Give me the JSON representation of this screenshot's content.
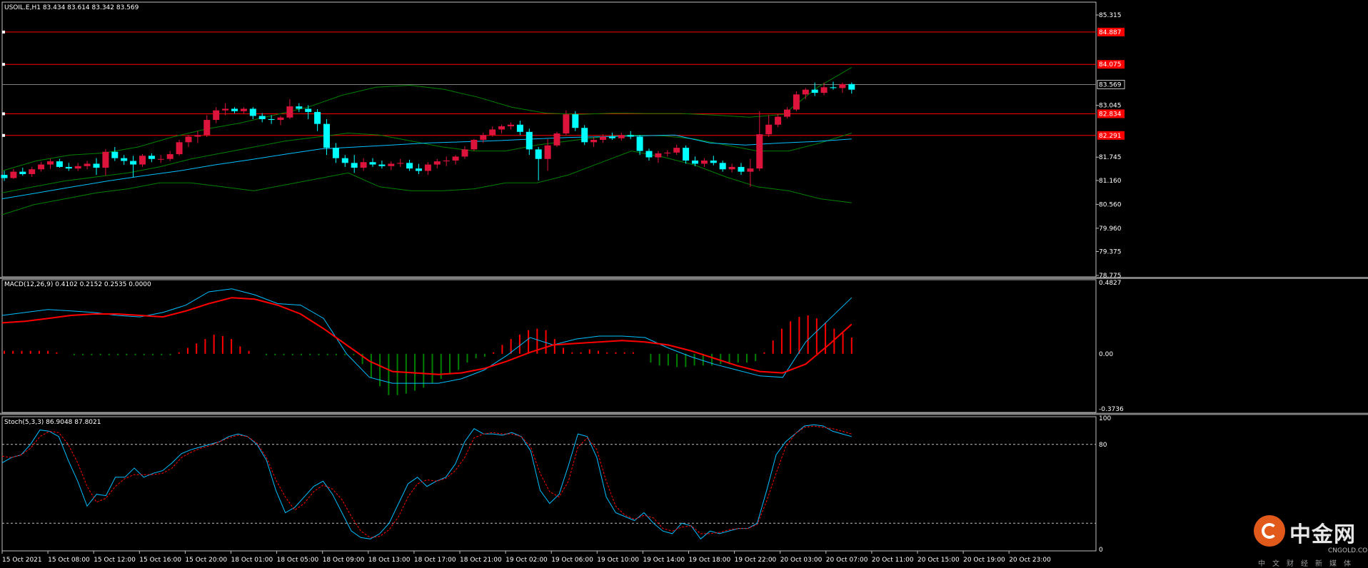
{
  "symbol_line": "USOIL.E,H1  83.434 83.614 83.342 83.569",
  "macd_label": "MACD(12,26,9) 0.4102 0.2152 0.2535 0.0000",
  "stoch_label": "Stoch(5,3,3) 86.9048 87.8021",
  "price_axis": [
    "85.315",
    "84.887",
    "84.075",
    "83.569",
    "83.045",
    "82.834",
    "82.291",
    "81.745",
    "81.160",
    "80.560",
    "79.960",
    "79.375",
    "78.775"
  ],
  "macd_axis": [
    "0.4827",
    "0.00",
    "-0.3736"
  ],
  "stoch_axis": [
    "100",
    "80",
    "0"
  ],
  "time_axis": [
    "15 Oct 2021",
    "15 Oct 08:00",
    "15 Oct 12:00",
    "15 Oct 16:00",
    "15 Oct 20:00",
    "18 Oct 01:00",
    "18 Oct 05:00",
    "18 Oct 09:00",
    "18 Oct 13:00",
    "18 Oct 17:00",
    "18 Oct 21:00",
    "19 Oct 02:00",
    "19 Oct 06:00",
    "19 Oct 10:00",
    "19 Oct 14:00",
    "19 Oct 18:00",
    "19 Oct 22:00",
    "20 Oct 03:00",
    "20 Oct 07:00",
    "20 Oct 11:00",
    "20 Oct 15:00",
    "20 Oct 19:00",
    "20 Oct 23:00"
  ],
  "logo": {
    "name": "中金网",
    "url": "CNGOLD.COM.CN",
    "sub": "中文财经新媒体"
  },
  "colors": {
    "bull": "#00ffff",
    "bear": "#dc143c",
    "macd_signal": "#ff0000",
    "macd_pos": "#ff0000",
    "macd_neg": "#008000",
    "bands": "#008000",
    "ma": "#00bfff",
    "level": "#ff0000",
    "grid": "#c0c0c0"
  },
  "chart_data": [
    {
      "type": "candlestick",
      "title": "USOIL.E,H1",
      "x_labels": [
        "15 Oct 2021",
        "15 Oct 08:00",
        "15 Oct 12:00",
        "15 Oct 16:00",
        "15 Oct 20:00",
        "18 Oct 01:00",
        "18 Oct 05:00",
        "18 Oct 09:00",
        "18 Oct 13:00",
        "18 Oct 17:00",
        "18 Oct 21:00",
        "19 Oct 02:00",
        "19 Oct 06:00",
        "19 Oct 10:00",
        "19 Oct 14:00",
        "19 Oct 18:00",
        "19 Oct 22:00",
        "20 Oct 03:00",
        "20 Oct 07:00",
        "20 Oct 11:00",
        "20 Oct 15:00",
        "20 Oct 19:00",
        "20 Oct 23:00"
      ],
      "ylim": [
        78.775,
        85.315
      ],
      "y_ticks": [
        85.315,
        84.887,
        84.075,
        83.569,
        83.045,
        82.834,
        82.291,
        81.745,
        81.16,
        80.56,
        79.96,
        79.375,
        78.775
      ],
      "current_price": 83.569,
      "levels": [
        84.887,
        84.075,
        82.834,
        82.291
      ],
      "ohlc": [
        [
          81.3,
          81.4,
          81.15,
          81.22
        ],
        [
          81.22,
          81.45,
          81.2,
          81.38
        ],
        [
          81.38,
          81.48,
          81.28,
          81.32
        ],
        [
          81.32,
          81.5,
          81.25,
          81.44
        ],
        [
          81.44,
          81.62,
          81.38,
          81.56
        ],
        [
          81.56,
          81.7,
          81.45,
          81.64
        ],
        [
          81.64,
          81.7,
          81.48,
          81.5
        ],
        [
          81.5,
          81.6,
          81.4,
          81.46
        ],
        [
          81.46,
          81.6,
          81.4,
          81.52
        ],
        [
          81.52,
          81.65,
          81.44,
          81.58
        ],
        [
          81.58,
          81.72,
          81.3,
          81.48
        ],
        [
          81.48,
          81.95,
          81.28,
          81.88
        ],
        [
          81.88,
          82.0,
          81.65,
          81.72
        ],
        [
          81.72,
          81.8,
          81.55,
          81.65
        ],
        [
          81.65,
          81.78,
          81.24,
          81.56
        ],
        [
          81.56,
          81.82,
          81.5,
          81.78
        ],
        [
          81.78,
          81.84,
          81.62,
          81.7
        ],
        [
          81.7,
          81.8,
          81.6,
          81.7
        ],
        [
          81.7,
          81.9,
          81.65,
          81.82
        ],
        [
          81.82,
          82.18,
          81.78,
          82.12
        ],
        [
          82.12,
          82.3,
          82.0,
          82.26
        ],
        [
          82.26,
          82.4,
          82.1,
          82.3
        ],
        [
          82.3,
          82.8,
          82.25,
          82.68
        ],
        [
          82.68,
          83.0,
          82.6,
          82.92
        ],
        [
          82.92,
          83.1,
          82.8,
          82.96
        ],
        [
          82.96,
          83.0,
          82.85,
          82.9
        ],
        [
          82.9,
          83.0,
          82.82,
          82.96
        ],
        [
          82.96,
          83.0,
          82.7,
          82.78
        ],
        [
          82.78,
          82.85,
          82.62,
          82.7
        ],
        [
          82.7,
          82.8,
          82.58,
          82.68
        ],
        [
          82.68,
          82.78,
          82.55,
          82.74
        ],
        [
          82.74,
          83.2,
          82.7,
          83.02
        ],
        [
          83.02,
          83.1,
          82.88,
          82.96
        ],
        [
          82.96,
          83.05,
          82.7,
          82.88
        ],
        [
          82.88,
          82.95,
          82.4,
          82.58
        ],
        [
          82.58,
          82.7,
          81.8,
          81.98
        ],
        [
          81.98,
          82.1,
          81.6,
          81.72
        ],
        [
          81.72,
          81.8,
          81.5,
          81.6
        ],
        [
          81.6,
          81.8,
          81.35,
          81.48
        ],
        [
          81.48,
          81.72,
          81.4,
          81.62
        ],
        [
          81.62,
          81.72,
          81.5,
          81.56
        ],
        [
          81.56,
          81.66,
          81.46,
          81.52
        ],
        [
          81.52,
          81.64,
          81.42,
          81.58
        ],
        [
          81.58,
          81.7,
          81.5,
          81.6
        ],
        [
          81.6,
          81.68,
          81.4,
          81.46
        ],
        [
          81.46,
          81.58,
          81.32,
          81.4
        ],
        [
          81.4,
          81.62,
          81.3,
          81.56
        ],
        [
          81.56,
          81.7,
          81.46,
          81.64
        ],
        [
          81.64,
          81.76,
          81.52,
          81.66
        ],
        [
          81.66,
          81.8,
          81.56,
          81.76
        ],
        [
          81.76,
          82.02,
          81.7,
          81.94
        ],
        [
          81.94,
          82.2,
          81.9,
          82.18
        ],
        [
          82.18,
          82.36,
          82.1,
          82.3
        ],
        [
          82.3,
          82.52,
          82.26,
          82.44
        ],
        [
          82.44,
          82.56,
          82.34,
          82.52
        ],
        [
          82.52,
          82.62,
          82.44,
          82.56
        ],
        [
          82.56,
          82.66,
          82.3,
          82.38
        ],
        [
          82.38,
          82.46,
          81.8,
          81.94
        ],
        [
          81.94,
          82.0,
          81.16,
          81.7
        ],
        [
          81.7,
          82.2,
          81.4,
          82.04
        ],
        [
          82.04,
          82.38,
          82.0,
          82.34
        ],
        [
          82.34,
          82.92,
          82.3,
          82.82
        ],
        [
          82.82,
          82.9,
          82.4,
          82.48
        ],
        [
          82.48,
          82.55,
          82.05,
          82.12
        ],
        [
          82.12,
          82.26,
          82.0,
          82.18
        ],
        [
          82.18,
          82.32,
          82.1,
          82.26
        ],
        [
          82.26,
          82.36,
          82.18,
          82.22
        ],
        [
          82.22,
          82.36,
          82.16,
          82.3
        ],
        [
          82.3,
          82.4,
          82.2,
          82.26
        ],
        [
          82.26,
          82.3,
          81.8,
          81.9
        ],
        [
          81.9,
          81.96,
          81.66,
          81.74
        ],
        [
          81.74,
          81.9,
          81.6,
          81.84
        ],
        [
          81.84,
          81.92,
          81.76,
          81.86
        ],
        [
          81.86,
          82.06,
          81.8,
          81.98
        ],
        [
          81.98,
          82.04,
          81.58,
          81.66
        ],
        [
          81.66,
          81.76,
          81.52,
          81.58
        ],
        [
          81.58,
          81.72,
          81.5,
          81.66
        ],
        [
          81.66,
          81.78,
          81.54,
          81.6
        ],
        [
          81.6,
          81.66,
          81.38,
          81.44
        ],
        [
          81.44,
          81.58,
          81.36,
          81.5
        ],
        [
          81.5,
          81.6,
          81.3,
          81.38
        ],
        [
          81.38,
          81.7,
          81.0,
          81.46
        ],
        [
          81.46,
          82.9,
          81.4,
          82.32
        ],
        [
          82.32,
          82.8,
          82.25,
          82.56
        ],
        [
          82.56,
          82.84,
          82.5,
          82.76
        ],
        [
          82.76,
          83.0,
          82.72,
          82.94
        ],
        [
          82.94,
          83.4,
          82.9,
          83.32
        ],
        [
          83.32,
          83.48,
          83.2,
          83.44
        ],
        [
          83.44,
          83.62,
          83.28,
          83.36
        ],
        [
          83.36,
          83.62,
          83.3,
          83.5
        ],
        [
          83.5,
          83.64,
          83.44,
          83.48
        ],
        [
          83.48,
          83.62,
          83.36,
          83.58
        ],
        [
          83.58,
          83.62,
          83.34,
          83.44
        ]
      ],
      "moving_average": [
        80.7,
        80.85,
        81.0,
        81.15,
        81.28,
        81.4,
        81.55,
        81.68,
        81.82,
        81.95,
        82.0,
        82.05,
        82.1,
        82.13,
        82.16,
        82.2,
        82.24,
        82.26,
        82.28,
        82.3,
        82.1,
        82.05,
        82.1,
        82.14,
        82.2
      ],
      "bollinger_upper": [
        81.4,
        81.65,
        81.8,
        81.85,
        82.0,
        82.25,
        82.45,
        82.6,
        82.8,
        83.0,
        83.3,
        83.5,
        83.55,
        83.45,
        83.25,
        83.0,
        82.85,
        82.82,
        82.85,
        82.84,
        82.84,
        82.8,
        82.75,
        82.82,
        83.5,
        84.0
      ],
      "bollinger_middle": [
        80.85,
        81.0,
        81.15,
        81.25,
        81.35,
        81.5,
        81.7,
        81.85,
        82.0,
        82.15,
        82.25,
        82.35,
        82.3,
        82.15,
        82.0,
        81.9,
        81.9,
        82.05,
        82.15,
        82.25,
        82.3,
        82.28,
        82.2,
        82.05,
        81.9,
        81.9,
        82.1,
        82.35
      ],
      "bollinger_lower": [
        80.3,
        80.55,
        80.7,
        80.85,
        80.95,
        81.1,
        81.1,
        81.0,
        80.9,
        81.05,
        81.2,
        81.35,
        81.0,
        80.9,
        80.9,
        80.95,
        81.1,
        81.1,
        81.3,
        81.6,
        81.9,
        81.75,
        81.55,
        81.25,
        81.0,
        80.9,
        80.7,
        80.6
      ]
    },
    {
      "type": "macd",
      "title": "MACD(12,26,9)",
      "ylim": [
        -0.3736,
        0.4827
      ],
      "y_ticks": [
        0.4827,
        0.0,
        -0.3736
      ],
      "macd": [
        0.26,
        0.28,
        0.3,
        0.29,
        0.28,
        0.26,
        0.25,
        0.28,
        0.33,
        0.42,
        0.44,
        0.4,
        0.34,
        0.33,
        0.24,
        0.0,
        -0.16,
        -0.2,
        -0.2,
        -0.2,
        -0.17,
        -0.11,
        -0.01,
        0.11,
        0.06,
        0.1,
        0.12,
        0.12,
        0.11,
        0.04,
        -0.02,
        -0.07,
        -0.11,
        -0.15,
        -0.16,
        0.08,
        0.23,
        0.38
      ],
      "signal": [
        0.21,
        0.22,
        0.24,
        0.26,
        0.27,
        0.27,
        0.26,
        0.25,
        0.29,
        0.34,
        0.38,
        0.37,
        0.33,
        0.27,
        0.17,
        0.06,
        -0.05,
        -0.12,
        -0.13,
        -0.14,
        -0.13,
        -0.1,
        -0.05,
        0.01,
        0.06,
        0.07,
        0.08,
        0.09,
        0.08,
        0.06,
        0.02,
        -0.03,
        -0.08,
        -0.12,
        -0.13,
        -0.07,
        0.06,
        0.2
      ],
      "histogram": [
        0.02,
        0.02,
        0.02,
        0.02,
        0.02,
        0.02,
        0.01,
        0.0,
        -0.01,
        -0.01,
        -0.01,
        -0.01,
        -0.01,
        -0.01,
        -0.01,
        -0.01,
        -0.01,
        -0.01,
        -0.01,
        -0.01,
        0.01,
        0.04,
        0.07,
        0.1,
        0.13,
        0.12,
        0.1,
        0.05,
        0.02,
        0.0,
        -0.01,
        -0.01,
        -0.01,
        -0.01,
        -0.01,
        -0.01,
        -0.01,
        -0.01,
        -0.01,
        -0.01,
        -0.01,
        -0.07,
        -0.16,
        -0.22,
        -0.28,
        -0.28,
        -0.27,
        -0.25,
        -0.23,
        -0.2,
        -0.17,
        -0.14,
        -0.11,
        -0.06,
        -0.03,
        -0.02,
        0.01,
        0.06,
        0.1,
        0.13,
        0.16,
        0.17,
        0.16,
        0.1,
        0.04,
        0.01,
        0.01,
        0.03,
        0.02,
        0.01,
        0.01,
        0.01,
        0.01,
        0.0,
        -0.06,
        -0.08,
        -0.08,
        -0.09,
        -0.09,
        -0.08,
        -0.08,
        -0.08,
        -0.07,
        -0.07,
        -0.06,
        -0.06,
        -0.05,
        0.01,
        0.09,
        0.17,
        0.22,
        0.25,
        0.26,
        0.24,
        0.21,
        0.17,
        0.14,
        0.11
      ]
    },
    {
      "type": "line",
      "title": "Stoch(5,3,3)",
      "ylim": [
        0,
        100
      ],
      "y_ticks": [
        100,
        80,
        0
      ],
      "levels": [
        80,
        20
      ],
      "main": [
        66,
        70,
        72,
        80,
        91,
        90,
        86,
        68,
        52,
        33,
        42,
        41,
        55,
        55,
        62,
        55,
        58,
        60,
        66,
        73,
        76,
        78,
        80,
        82,
        86,
        88,
        86,
        80,
        68,
        45,
        28,
        32,
        40,
        48,
        52,
        42,
        28,
        14,
        9,
        8,
        12,
        20,
        35,
        50,
        55,
        48,
        52,
        55,
        65,
        82,
        92,
        88,
        88,
        87,
        89,
        86,
        75,
        45,
        35,
        42,
        64,
        88,
        86,
        70,
        40,
        28,
        25,
        22,
        28,
        20,
        14,
        12,
        20,
        18,
        8,
        14,
        12,
        14,
        16,
        16,
        20,
        45,
        72,
        82,
        88,
        94,
        95,
        94,
        90,
        88,
        86
      ],
      "signal": [
        71,
        70,
        72,
        77,
        86,
        90,
        89,
        80,
        66,
        48,
        36,
        39,
        48,
        54,
        57,
        57,
        57,
        58,
        62,
        70,
        74,
        77,
        79,
        82,
        85,
        87,
        86,
        81,
        70,
        53,
        40,
        30,
        35,
        44,
        49,
        46,
        38,
        25,
        14,
        9,
        10,
        15,
        25,
        40,
        50,
        53,
        52,
        54,
        60,
        70,
        85,
        88,
        89,
        88,
        88,
        86,
        78,
        58,
        44,
        40,
        52,
        78,
        85,
        76,
        52,
        33,
        26,
        23,
        26,
        24,
        16,
        14,
        17,
        18,
        12,
        12,
        13,
        15,
        16,
        16,
        19,
        37,
        58,
        78,
        88,
        93,
        94,
        93,
        92,
        90,
        88
      ]
    }
  ]
}
